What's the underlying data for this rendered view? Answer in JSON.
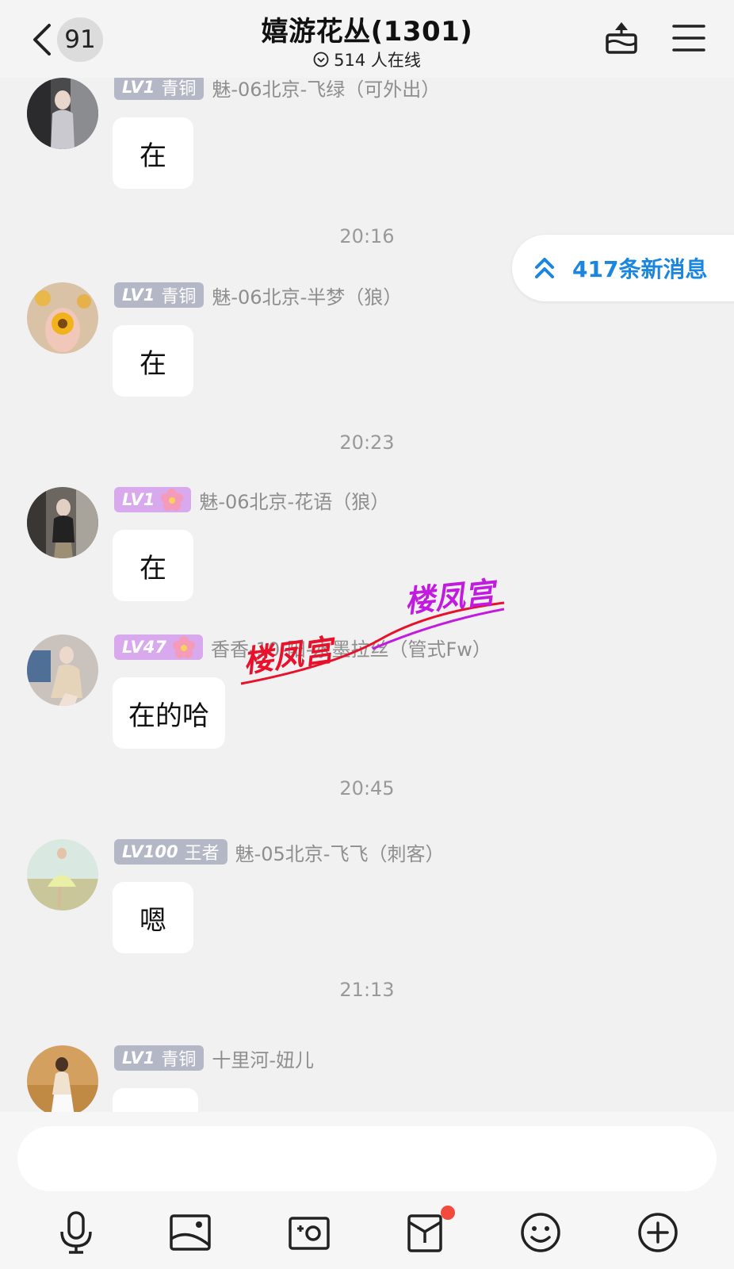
{
  "header": {
    "back_count": "91",
    "title": "嬉游花丛(1301)",
    "online": "514 人在线"
  },
  "new_messages": "417条新消息",
  "messages": [
    {
      "level": "LV1",
      "rank": "青铜",
      "sender": "魅-06北京-飞绿（可外出）",
      "text": "在"
    },
    {
      "time": "20:16"
    },
    {
      "level": "LV1",
      "rank": "青铜",
      "sender": "魅-06北京-半梦（狼）",
      "text": "在"
    },
    {
      "time": "20:23"
    },
    {
      "level": "LV1",
      "rank": "flower",
      "sender": "魅-06北京-花语（狼）",
      "text": "在"
    },
    {
      "level": "LV47",
      "rank": "flower",
      "sender": "香香-10-阳-水墨拉丝（管式Fw）",
      "text": "在的哈"
    },
    {
      "time": "20:45"
    },
    {
      "level": "LV100",
      "rank": "王者",
      "sender": "魅-05北京-飞飞（刺客）",
      "text": "嗯"
    },
    {
      "time": "21:13"
    },
    {
      "level": "LV1",
      "rank": "青铜",
      "sender": "十里河-妞儿",
      "text": ""
    }
  ],
  "watermark": {
    "text_1": "楼凤宫",
    "text_2": "楼凤宫"
  },
  "colors": {
    "accent": "#1a86e0",
    "badge_gray": "#b4b8c6",
    "badge_purple": "#d9a9ee",
    "watermark_red": "#e8102a",
    "watermark_purple": "#c31ae0"
  },
  "toolbar": {
    "icons": [
      "microphone-icon",
      "image-icon",
      "camera-icon",
      "red-packet-icon",
      "emoji-icon",
      "plus-icon"
    ]
  }
}
